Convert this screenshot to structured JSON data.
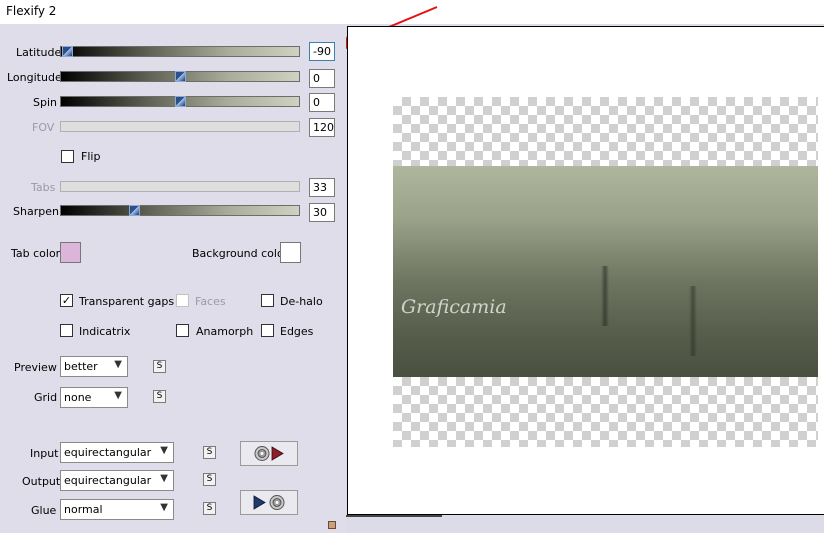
{
  "window": {
    "title": "Flexify 2"
  },
  "controls": {
    "latitude": {
      "label": "Latitude",
      "value": "-90"
    },
    "longitude": {
      "label": "Longitude",
      "value": "0"
    },
    "spin": {
      "label": "Spin",
      "value": "0"
    },
    "fov": {
      "label": "FOV",
      "value": "120"
    },
    "flip": {
      "label": "Flip",
      "checked": false
    },
    "tabs": {
      "label": "Tabs",
      "value": "33"
    },
    "sharpen": {
      "label": "Sharpen",
      "value": "30"
    }
  },
  "colors": {
    "tab_color_label": "Tab color",
    "tab_color": "#dcb6da",
    "background_color_label": "Background color",
    "background_color": "#ffffff"
  },
  "options": {
    "transparent_gaps": {
      "label": "Transparent gaps",
      "checked": true
    },
    "faces": {
      "label": "Faces",
      "checked": false,
      "enabled": false
    },
    "de_halo": {
      "label": "De-halo",
      "checked": false
    },
    "indicatrix": {
      "label": "Indicatrix",
      "checked": false
    },
    "anamorph": {
      "label": "Anamorph",
      "checked": false
    },
    "edges": {
      "label": "Edges",
      "checked": false
    }
  },
  "selects": {
    "preview": {
      "label": "Preview",
      "value": "better"
    },
    "grid": {
      "label": "Grid",
      "value": "none"
    },
    "input": {
      "label": "Input",
      "value": "equirectangular"
    },
    "output": {
      "label": "Output",
      "value": "equirectangular"
    },
    "glue": {
      "label": "Glue",
      "value": "normal"
    }
  },
  "small_button_label": "S",
  "watermark": "Graficamia",
  "icons": {
    "annotation_arrow": "red-arrow-icon",
    "input_apply": "disc-play-icon",
    "output_apply": "play-disc-icon"
  }
}
